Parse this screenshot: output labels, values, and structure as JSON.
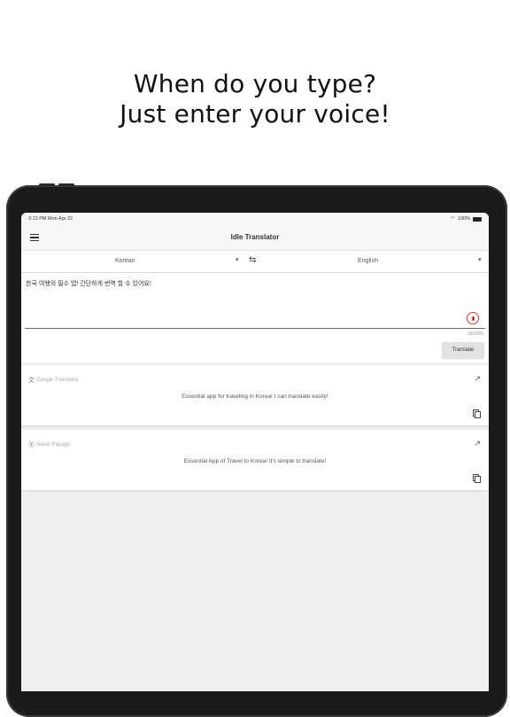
{
  "headline": {
    "line1": "When do you type?",
    "line2": "Just enter your voice!"
  },
  "status": {
    "time": "2:13 PM  Mon Apr 22",
    "battery": "100%"
  },
  "app": {
    "title": "Idle Translator"
  },
  "languages": {
    "source": "Korean",
    "target": "English"
  },
  "input": {
    "text": "한국 여행의 필수 앱! 간단하게 번역 할 수 있어요!",
    "count": "28/2000"
  },
  "buttons": {
    "translate": "Translate"
  },
  "results": [
    {
      "source": "Google Translator",
      "text": "Essential app for traveling in Korea! I can translate easily!"
    },
    {
      "source": "Naver Papago",
      "text": "Essential App of Travel to Korea! It's simple to translate!"
    }
  ],
  "colors": {
    "accent_red": "#d33333",
    "background": "#efefef"
  }
}
